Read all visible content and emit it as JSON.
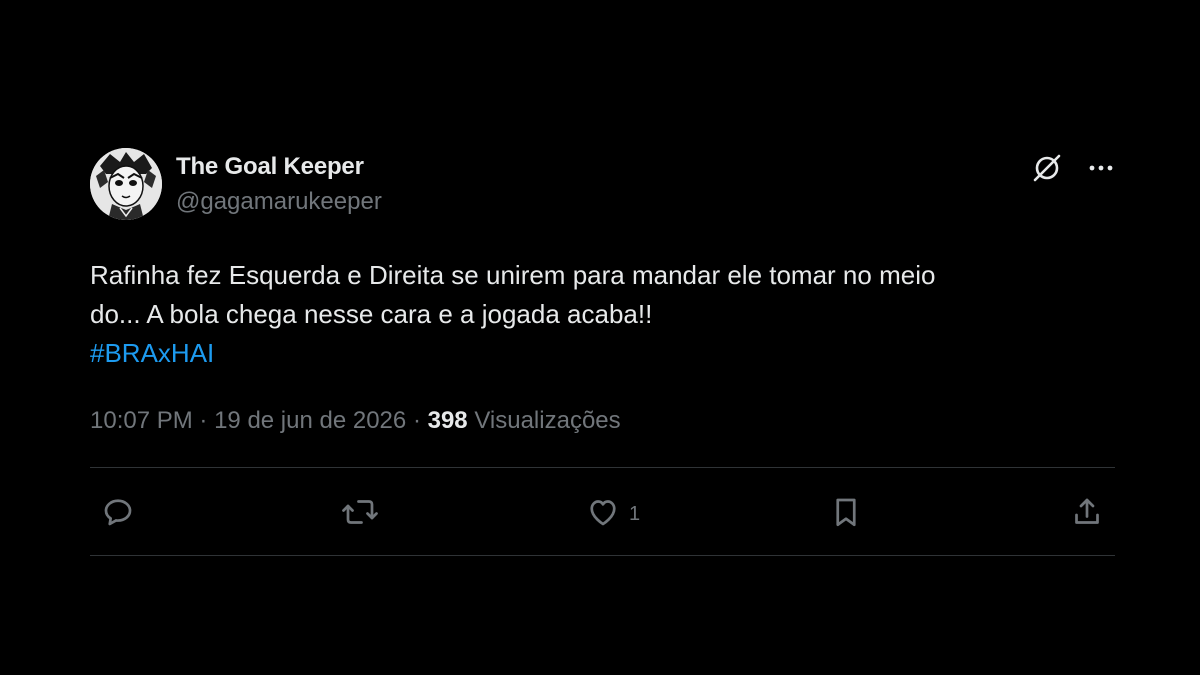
{
  "author": {
    "display_name": "The Goal Keeper",
    "handle": "@gagamarukeeper",
    "avatar_icon": "avatar-illustration"
  },
  "tweet": {
    "text_line1": "Rafinha fez Esquerda e Direita se unirem para mandar ele tomar no meio",
    "text_line2": "do... A bola chega nesse cara e a jogada acaba!!",
    "hashtag": "#BRAxHAI"
  },
  "meta": {
    "time": "10:07 PM",
    "separator": "·",
    "date": "19 de jun de 2026",
    "views_count": "398",
    "views_label": "Visualizações"
  },
  "actions": {
    "reply_icon": "reply-icon",
    "retweet_icon": "retweet-icon",
    "like_icon": "heart-icon",
    "like_count": "1",
    "bookmark_icon": "bookmark-icon",
    "share_icon": "share-icon"
  },
  "header_icons": [
    "grok-icon",
    "more-icon"
  ],
  "colors": {
    "background": "#000000",
    "text_primary": "#e7e9ea",
    "text_secondary": "#71767b",
    "link": "#1d9bf0",
    "divider": "#2f3336"
  }
}
